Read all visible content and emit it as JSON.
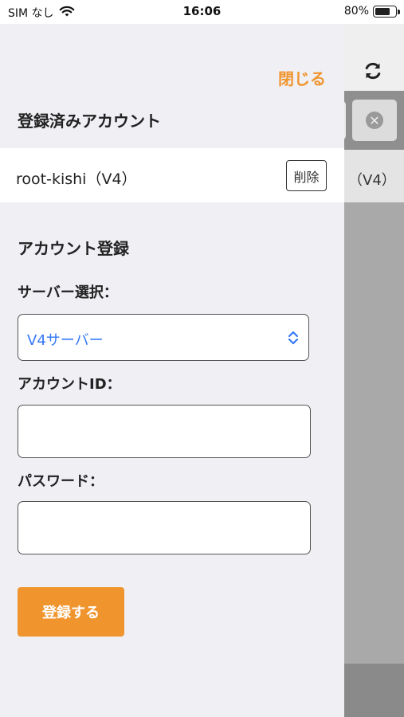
{
  "status_bar": {
    "carrier": "SIM なし",
    "time": "16:06",
    "battery_percent": "80%",
    "battery_level": 0.8
  },
  "background_app": {
    "refresh_icon": "refresh-icon",
    "clear_icon": "close-circle-icon",
    "row_text": "（V4）"
  },
  "panel": {
    "close_label": "閉じる",
    "registered_section_title": "登録済みアカウント",
    "accounts": [
      {
        "name": "root-kishi（V4）",
        "delete_label": "削除"
      }
    ],
    "register_section_title": "アカウント登録",
    "server_label": "サーバー選択：",
    "server_selected": "V4サーバー",
    "account_id_label": "アカウントID：",
    "account_id_value": "",
    "password_label": "パスワード：",
    "password_value": "",
    "submit_label": "登録する"
  },
  "colors": {
    "accent": "#f0952e",
    "select_text": "#3478f6",
    "panel_bg": "#efeff4"
  }
}
